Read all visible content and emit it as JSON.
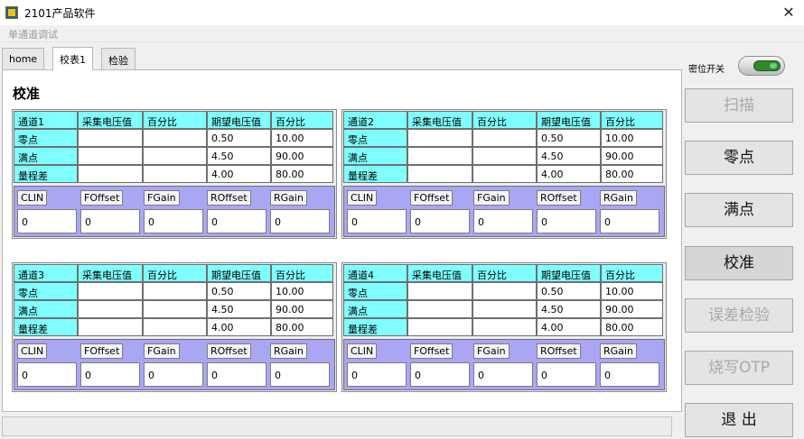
{
  "window": {
    "title": "2101产品软件",
    "close_glyph": "✕",
    "icon": "app-icon"
  },
  "menu": {
    "item": "单通道调试"
  },
  "tabs": [
    "home",
    "校表1",
    "检验"
  ],
  "active_tab": 1,
  "section_title": "校准",
  "columns": [
    "采集电压值",
    "百分比",
    "期望电压值",
    "百分比"
  ],
  "row_labels": [
    "零点",
    "满点",
    "量程差"
  ],
  "param_headers": [
    "CLIN",
    "FOffset",
    "FGain",
    "ROffset",
    "RGain"
  ],
  "channels": [
    {
      "name": "通道1",
      "rows": [
        [
          "",
          "",
          "0.50",
          "10.00"
        ],
        [
          "",
          "",
          "4.50",
          "90.00"
        ],
        [
          "",
          "",
          "4.00",
          "80.00"
        ]
      ],
      "params": [
        "0",
        "0",
        "0",
        "0",
        "0"
      ]
    },
    {
      "name": "通道2",
      "rows": [
        [
          "",
          "",
          "0.50",
          "10.00"
        ],
        [
          "",
          "",
          "4.50",
          "90.00"
        ],
        [
          "",
          "",
          "4.00",
          "80.00"
        ]
      ],
      "params": [
        "0",
        "0",
        "0",
        "0",
        "0"
      ]
    },
    {
      "name": "通道3",
      "rows": [
        [
          "",
          "",
          "0.50",
          "10.00"
        ],
        [
          "",
          "",
          "4.50",
          "90.00"
        ],
        [
          "",
          "",
          "4.00",
          "80.00"
        ]
      ],
      "params": [
        "0",
        "0",
        "0",
        "0",
        "0"
      ]
    },
    {
      "name": "通道4",
      "rows": [
        [
          "",
          "",
          "0.50",
          "10.00"
        ],
        [
          "",
          "",
          "4.50",
          "90.00"
        ],
        [
          "",
          "",
          "4.00",
          "80.00"
        ]
      ],
      "params": [
        "0",
        "0",
        "0",
        "0",
        "0"
      ]
    }
  ],
  "switch": {
    "label": "密位开关",
    "state": "on"
  },
  "side_buttons": [
    {
      "id": "scan",
      "label": "扫描",
      "state": "disabled"
    },
    {
      "id": "zero",
      "label": "零点",
      "state": "enabled"
    },
    {
      "id": "full",
      "label": "满点",
      "state": "enabled"
    },
    {
      "id": "calibrate",
      "label": "校准",
      "state": "pressed"
    },
    {
      "id": "error-check",
      "label": "误差检验",
      "state": "disabled"
    },
    {
      "id": "burn-otp",
      "label": "烧写OTP",
      "state": "disabled"
    },
    {
      "id": "exit",
      "label": "退 出",
      "state": "enabled"
    }
  ],
  "colors": {
    "header_cyan": "#7fffff",
    "param_purple": "#a9a6f4",
    "switch_green": "#2f8a2f"
  }
}
